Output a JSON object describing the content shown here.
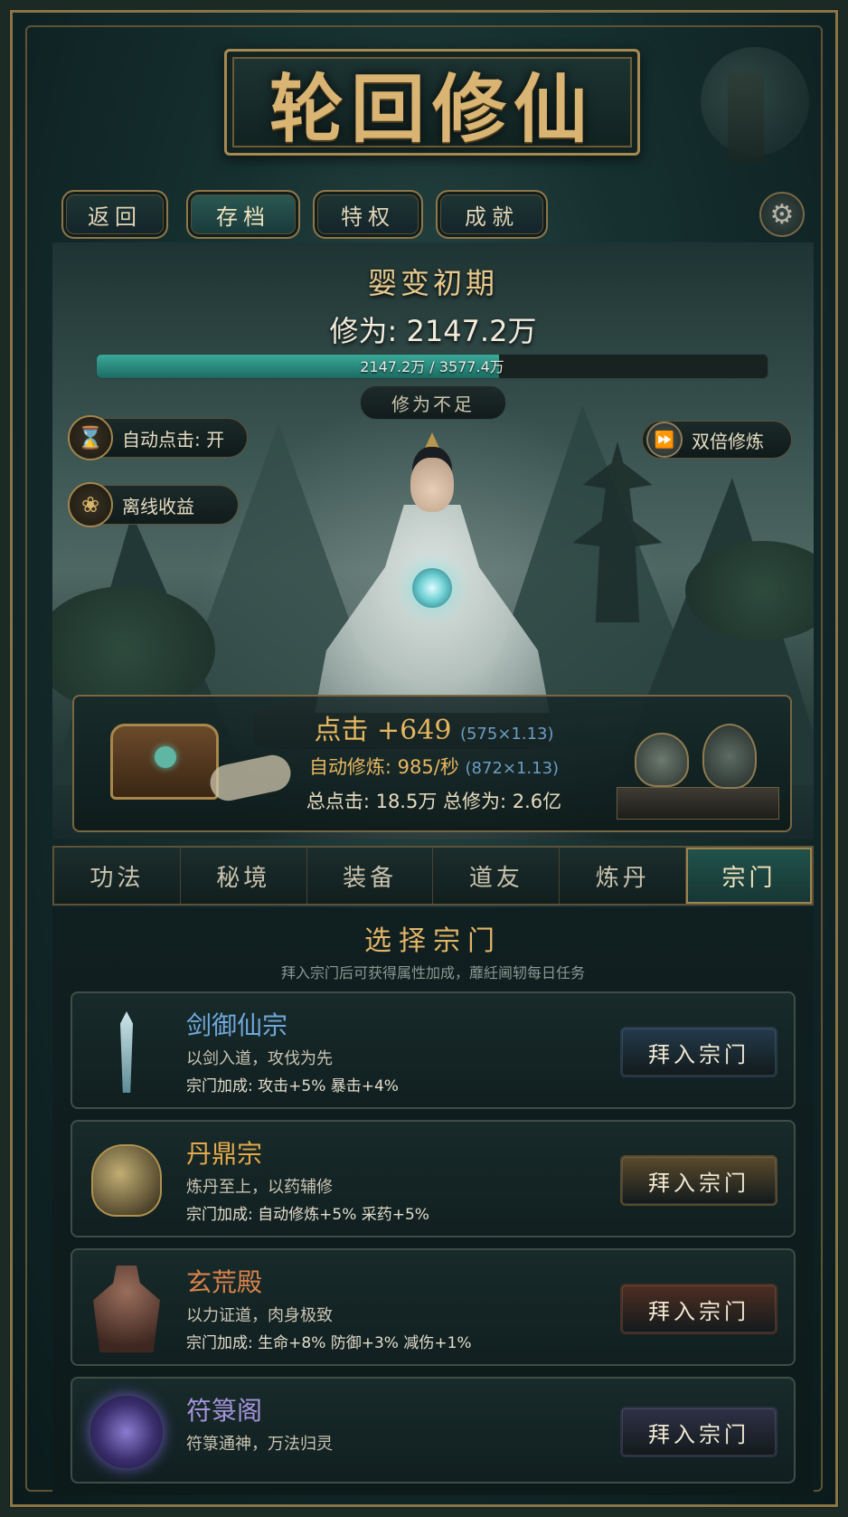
{
  "title": "轮回修仙",
  "nav": [
    {
      "label": "返回",
      "active": false
    },
    {
      "label": "存档",
      "active": true
    },
    {
      "label": "特权",
      "active": false
    },
    {
      "label": "成就",
      "active": false
    }
  ],
  "icons": {
    "settings": "gear-icon",
    "settings_small": "gear-icon",
    "auto_click": "hourglass-icon",
    "offline": "lotus-icon",
    "double": "fast-forward-icon"
  },
  "status": {
    "realm": "婴变初期",
    "cultivation": "修为: 2147.2万",
    "progress_text": "2147.2万 / 3577.4万",
    "progress_fraction": 0.6,
    "insufficient": "修为不足"
  },
  "buttons": {
    "auto_click": "自动点击: 开",
    "offline": "离线收益",
    "double": "双倍修炼"
  },
  "stats": {
    "click_main": "点击 +649",
    "click_sub": "(575×1.13)",
    "auto_main": "自动修炼: 985/秒",
    "auto_sub": "(872×1.13)",
    "totals": "总点击: 18.5万  总修为: 2.6亿"
  },
  "tabs": [
    {
      "label": "功法",
      "active": false
    },
    {
      "label": "秘境",
      "active": false
    },
    {
      "label": "装备",
      "active": false
    },
    {
      "label": "道友",
      "active": false
    },
    {
      "label": "炼丹",
      "active": false
    },
    {
      "label": "宗门",
      "active": true
    }
  ],
  "sect": {
    "title": "选择宗门",
    "subtitle": "拜入宗门后可获得属性加成，蘼紝阃轫每日任务",
    "cards": [
      {
        "name": "剑御仙宗",
        "desc": "以剑入道，攻伐为先",
        "bonus": "宗门加成: 攻击+5%  暴击+4%",
        "button": "拜入宗门",
        "name_color": "#6fa8dc",
        "btn_color": "#243a4a",
        "icon": "sword-icon"
      },
      {
        "name": "丹鼎宗",
        "desc": "炼丹至上，以药辅修",
        "bonus": "宗门加成: 自动修炼+5%  采药+5%",
        "button": "拜入宗门",
        "name_color": "#e3a94a",
        "btn_color": "#5a4a2c",
        "icon": "cauldron-icon"
      },
      {
        "name": "玄荒殿",
        "desc": "以力证道，肉身极致",
        "bonus": "宗门加成: 生命+8%  防御+3%  减伤+1%",
        "button": "拜入宗门",
        "name_color": "#d9824a",
        "btn_color": "#4e2e22",
        "icon": "warrior-icon"
      },
      {
        "name": "符箓阁",
        "desc": "符箓通神，万法归灵",
        "bonus": "",
        "button": "拜入宗门",
        "name_color": "#a595dd",
        "btn_color": "#2e3146",
        "icon": "meditation-icon"
      }
    ]
  }
}
